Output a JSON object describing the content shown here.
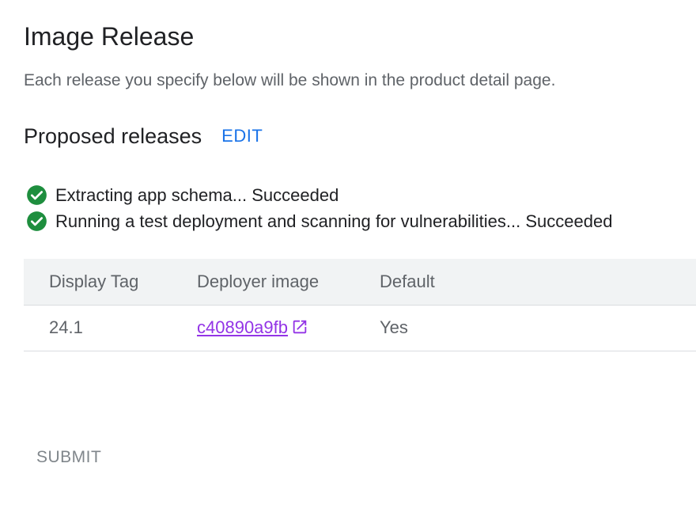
{
  "header": {
    "title": "Image Release",
    "description": "Each release you specify below will be shown in the product detail page."
  },
  "proposed": {
    "title": "Proposed releases",
    "edit_label": "EDIT"
  },
  "status": {
    "icon": "check-circle-icon",
    "color": "#1e8e3e",
    "items": [
      "Extracting app schema... Succeeded",
      "Running a test deployment and scanning for vulnerabilities... Succeeded"
    ]
  },
  "table": {
    "headers": [
      "Display Tag",
      "Deployer image",
      "Default"
    ],
    "rows": [
      {
        "display_tag": "24.1",
        "deployer_image": "c40890a9fb",
        "default": "Yes"
      }
    ]
  },
  "footer": {
    "submit_label": "SUBMIT"
  }
}
